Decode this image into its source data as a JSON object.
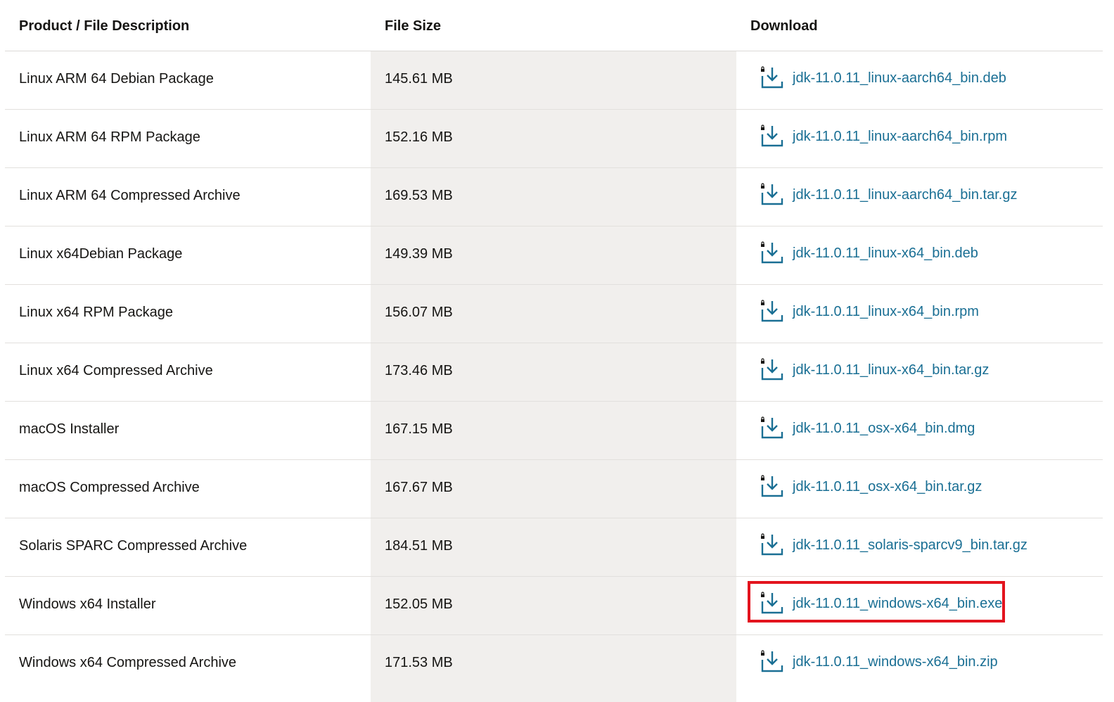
{
  "table": {
    "headers": {
      "description": "Product / File Description",
      "size": "File Size",
      "download": "Download"
    },
    "rows": [
      {
        "description": "Linux ARM 64 Debian Package",
        "size": "145.61 MB",
        "file": "jdk-11.0.11_linux-aarch64_bin.deb"
      },
      {
        "description": "Linux ARM 64 RPM Package",
        "size": "152.16 MB",
        "file": "jdk-11.0.11_linux-aarch64_bin.rpm"
      },
      {
        "description": "Linux ARM 64 Compressed Archive",
        "size": "169.53 MB",
        "file": "jdk-11.0.11_linux-aarch64_bin.tar.gz"
      },
      {
        "description": "Linux x64Debian Package",
        "size": "149.39 MB",
        "file": "jdk-11.0.11_linux-x64_bin.deb"
      },
      {
        "description": "Linux x64 RPM Package",
        "size": "156.07 MB",
        "file": "jdk-11.0.11_linux-x64_bin.rpm"
      },
      {
        "description": "Linux x64 Compressed Archive",
        "size": "173.46 MB",
        "file": "jdk-11.0.11_linux-x64_bin.tar.gz"
      },
      {
        "description": "macOS Installer",
        "size": "167.15 MB",
        "file": "jdk-11.0.11_osx-x64_bin.dmg"
      },
      {
        "description": "macOS Compressed Archive",
        "size": "167.67 MB",
        "file": "jdk-11.0.11_osx-x64_bin.tar.gz"
      },
      {
        "description": "Solaris SPARC Compressed Archive",
        "size": "184.51 MB",
        "file": "jdk-11.0.11_solaris-sparcv9_bin.tar.gz"
      },
      {
        "description": "Windows x64 Installer",
        "size": "152.05 MB",
        "file": "jdk-11.0.11_windows-x64_bin.exe"
      },
      {
        "description": "Windows x64 Compressed Archive",
        "size": "171.53 MB",
        "file": "jdk-11.0.11_windows-x64_bin.zip"
      }
    ]
  },
  "icons": {
    "download": "download-locked-icon"
  },
  "colors": {
    "link": "#1a6f94",
    "highlight": "#e3141e",
    "size_column_bg": "#f1efed"
  }
}
